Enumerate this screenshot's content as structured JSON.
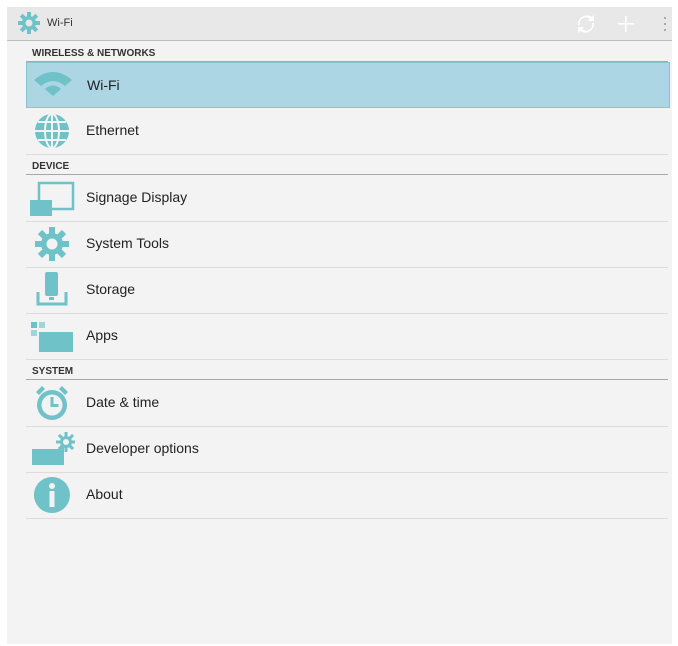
{
  "action_bar": {
    "title": "Wi-Fi",
    "title_icon": "gear-icon",
    "actions": [
      "scan-icon",
      "add-icon",
      "overflow-menu-icon"
    ]
  },
  "sections": {
    "wireless": "WIRELESS & NETWORKS",
    "device": "DEVICE",
    "system": "SYSTEM"
  },
  "items": {
    "wifi": "Wi-Fi",
    "ethernet": "Ethernet",
    "signage_display": "Signage Display",
    "system_tools": "System Tools",
    "storage": "Storage",
    "apps": "Apps",
    "date_time": "Date & time",
    "developer_options": "Developer options",
    "about": "About"
  },
  "selected_item": "wifi",
  "colors": {
    "icon_teal": "#6fc2c8",
    "selection": "#acd6e3",
    "background": "#f3f3f3"
  }
}
